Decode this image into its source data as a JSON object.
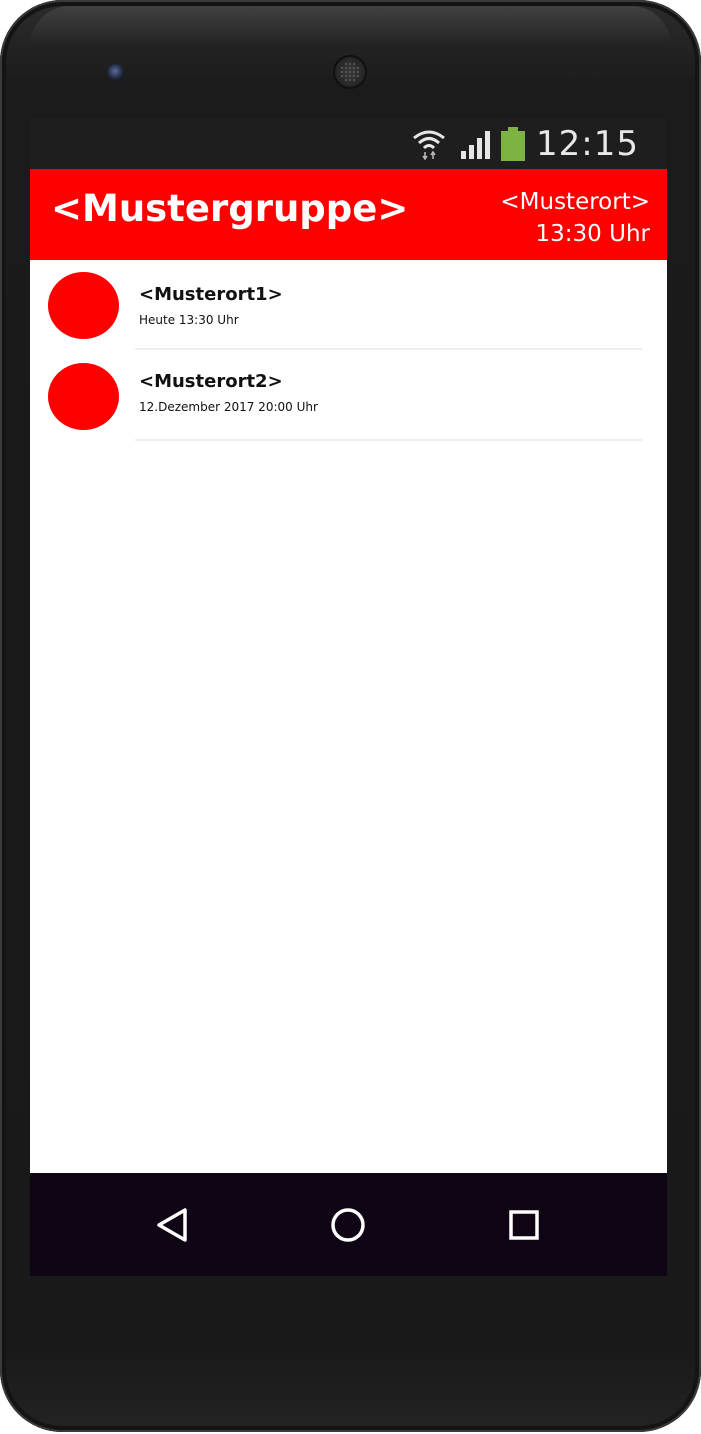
{
  "status_bar": {
    "time": "12:15",
    "icons": [
      "wifi-icon",
      "cellular-signal-icon",
      "battery-icon"
    ],
    "battery_color": "#7cb342"
  },
  "header": {
    "group_title": "<Mustergruppe>",
    "place": "<Musterort>",
    "time": "13:30 Uhr",
    "background": "#ff0000"
  },
  "list": {
    "items": [
      {
        "title": "<Musterort1>",
        "subtitle": "Heute 13:30 Uhr",
        "avatar_color": "#ff0000"
      },
      {
        "title": "<Musterort2>",
        "subtitle": "12.Dezember 2017 20:00 Uhr",
        "avatar_color": "#ff0000"
      }
    ]
  },
  "nav_bar": {
    "buttons": [
      "back-icon",
      "home-icon",
      "recent-apps-icon"
    ]
  }
}
